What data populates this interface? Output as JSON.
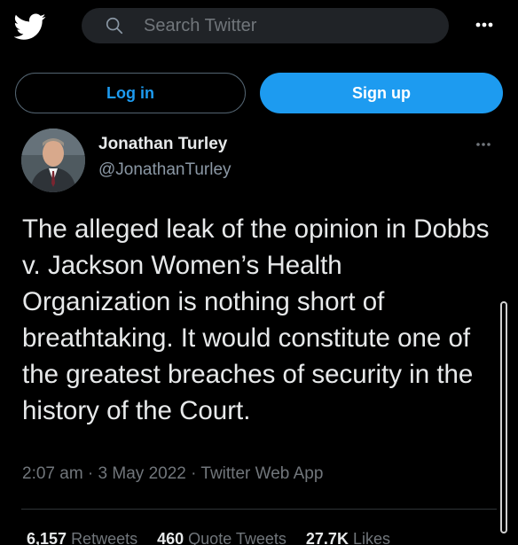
{
  "topbar": {
    "logo_icon": "twitter-bird-icon",
    "search_placeholder": "Search Twitter",
    "more_icon": "more-horizontal-icon"
  },
  "auth": {
    "login_label": "Log in",
    "signup_label": "Sign up"
  },
  "tweet": {
    "author_name": "Jonathan Turley",
    "author_handle": "@JonathanTurley",
    "text": "The alleged leak of the opinion in Dobbs v. Jackson Women’s Health Organization is nothing short of breathtaking. It would constitute one of the greatest breaches of security in the history of the Court.",
    "time": "2:07 am",
    "date": "3 May 2022",
    "source": "Twitter Web App",
    "separator": " · "
  },
  "stats": {
    "retweets_count": "6,157",
    "retweets_label": "Retweets",
    "quotes_count": "460",
    "quotes_label": "Quote Tweets",
    "likes_count": "27.7K",
    "likes_label": "Likes"
  },
  "colors": {
    "accent": "#1d9bf0",
    "background": "#000000",
    "muted": "#71767b"
  }
}
